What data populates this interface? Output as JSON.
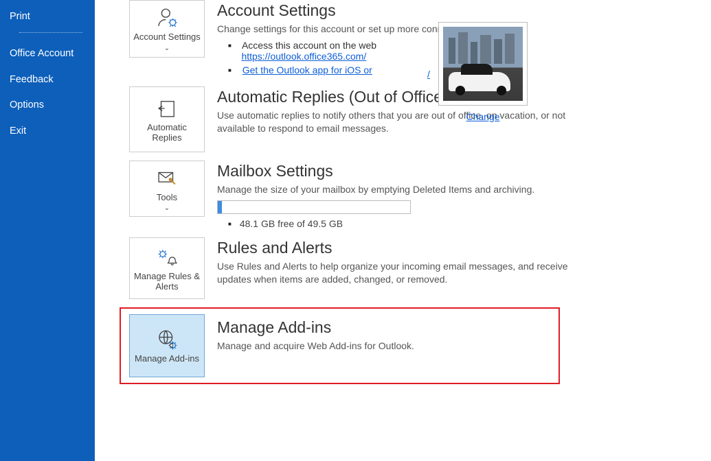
{
  "sidebar": {
    "print": "Print",
    "account": "Office Account",
    "feedback": "Feedback",
    "options": "Options",
    "exit": "Exit"
  },
  "account": {
    "tile_label": "Account Settings",
    "title": "Account Settings",
    "desc": "Change settings for this account or set up more connections.",
    "link1_text": "Access this account on the web",
    "link1_url": "https://outlook.office365.com/",
    "link2_text": "Get the Outlook app for iOS or",
    "slash": "/",
    "change": "Change"
  },
  "auto_replies": {
    "tile_label": "Automatic Replies",
    "title": "Automatic Replies (Out of Office)",
    "desc": "Use automatic replies to notify others that you are out of office, on vacation, or not available to respond to email messages."
  },
  "mailbox": {
    "tile_label": "Tools",
    "title": "Mailbox Settings",
    "desc": "Manage the size of your mailbox by emptying Deleted Items and archiving.",
    "storage": "48.1 GB free of 49.5 GB"
  },
  "rules": {
    "tile_label": "Manage Rules & Alerts",
    "title": "Rules and Alerts",
    "desc": "Use Rules and Alerts to help organize your incoming email messages, and receive updates when items are added, changed, or removed."
  },
  "addins": {
    "tile_label": "Manage Add-ins",
    "title": "Manage Add-ins",
    "desc": "Manage and acquire Web Add-ins for Outlook."
  }
}
